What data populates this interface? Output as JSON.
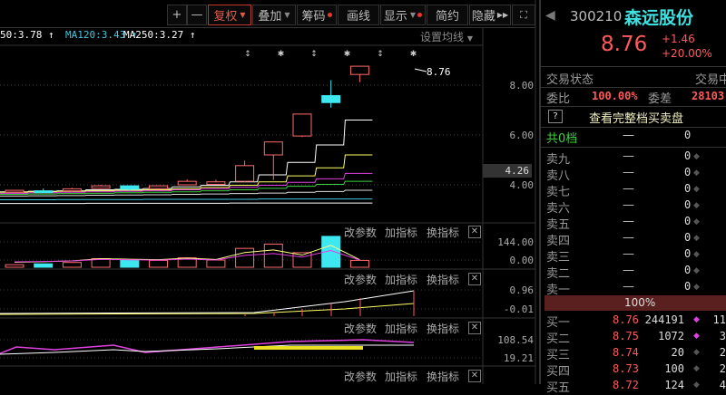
{
  "toolbar": {
    "zoom_in": "+",
    "zoom_out": "—",
    "fuquan": "复权",
    "overlay": "叠加",
    "chips": "筹码",
    "draw": "画线",
    "display": "显示",
    "simple": "简约",
    "hide": "隐藏"
  },
  "ma_legend": [
    {
      "text": "50:3.78",
      "color": "#ffffff"
    },
    {
      "text": "MA120:3.43",
      "color": "#3ec8e0"
    },
    {
      "text": "MA250:3.27",
      "color": "#ffffff"
    }
  ],
  "set_ma": "设置均线",
  "price_label": "8.76",
  "current_axis_value": "4.26",
  "main_axis": [
    "8.00",
    "6.00",
    "4.00"
  ],
  "panel_actions": {
    "params": "改参数",
    "add": "加指标",
    "swap": "换指标",
    "close": "✕"
  },
  "panels": [
    {
      "axis": [
        "144.00",
        "0.00"
      ]
    },
    {
      "axis": [
        "0.96",
        "-0.01"
      ]
    },
    {
      "axis": [
        "108.54",
        "19.21"
      ]
    }
  ],
  "chart_data": {
    "type": "candlestick",
    "ylim": [
      3.4,
      9.2
    ],
    "candles": [
      {
        "o": 3.72,
        "h": 3.79,
        "l": 3.7,
        "c": 3.78
      },
      {
        "o": 3.76,
        "h": 3.85,
        "l": 3.72,
        "c": 3.74
      },
      {
        "o": 3.76,
        "h": 3.88,
        "l": 3.73,
        "c": 3.84
      },
      {
        "o": 3.86,
        "h": 4.0,
        "l": 3.84,
        "c": 3.96
      },
      {
        "o": 3.96,
        "h": 3.96,
        "l": 3.78,
        "c": 3.82
      },
      {
        "o": 3.85,
        "h": 3.98,
        "l": 3.8,
        "c": 3.96
      },
      {
        "o": 4.0,
        "h": 4.22,
        "l": 3.98,
        "c": 4.14
      },
      {
        "o": 4.02,
        "h": 4.2,
        "l": 4.0,
        "c": 4.12
      },
      {
        "o": 4.14,
        "h": 4.97,
        "l": 4.1,
        "c": 4.77
      },
      {
        "o": 5.2,
        "h": 5.72,
        "l": 4.2,
        "c": 5.72
      },
      {
        "o": 5.96,
        "h": 6.84,
        "l": 5.92,
        "c": 6.84
      },
      {
        "o": 7.58,
        "h": 8.2,
        "l": 7.1,
        "c": 7.3
      },
      {
        "o": 8.43,
        "h": 8.76,
        "l": 8.12,
        "c": 8.76
      }
    ],
    "ma_series": [
      {
        "color": "#ffffff",
        "values": [
          3.72,
          3.74,
          3.76,
          3.8,
          3.82,
          3.85,
          3.92,
          3.98,
          4.12,
          4.4,
          4.9,
          5.6,
          6.6
        ]
      },
      {
        "color": "#ffff66",
        "values": [
          3.7,
          3.72,
          3.74,
          3.76,
          3.78,
          3.8,
          3.84,
          3.9,
          3.98,
          4.12,
          4.36,
          4.68,
          5.2
        ]
      },
      {
        "color": "#e040e0",
        "values": [
          3.66,
          3.68,
          3.7,
          3.72,
          3.74,
          3.76,
          3.8,
          3.84,
          3.9,
          3.98,
          4.1,
          4.24,
          4.46
        ]
      },
      {
        "color": "#40d040",
        "values": [
          3.62,
          3.63,
          3.65,
          3.66,
          3.68,
          3.7,
          3.72,
          3.76,
          3.8,
          3.86,
          3.94,
          4.02,
          4.14
        ]
      },
      {
        "color": "#dddddd",
        "values": [
          3.55,
          3.56,
          3.57,
          3.58,
          3.59,
          3.6,
          3.62,
          3.63,
          3.65,
          3.67,
          3.7,
          3.73,
          3.78
        ]
      },
      {
        "color": "#3ec8e0",
        "values": [
          3.4,
          3.4,
          3.41,
          3.41,
          3.41,
          3.42,
          3.42,
          3.42,
          3.42,
          3.43,
          3.43,
          3.43,
          3.43
        ]
      },
      {
        "color": "#ffffff",
        "values": [
          3.25,
          3.25,
          3.25,
          3.26,
          3.26,
          3.26,
          3.26,
          3.26,
          3.27,
          3.27,
          3.27,
          3.27,
          3.27
        ]
      }
    ],
    "volume": [
      15,
      20,
      28,
      50,
      45,
      40,
      55,
      42,
      110,
      135,
      85,
      180,
      40
    ],
    "volume_max": 190
  },
  "quote": {
    "code": "300210",
    "name": "森远股份",
    "price": "8.76",
    "change": "+1.46",
    "pct": "+20.00%",
    "status_label": "交易状态",
    "status_value": "交易中",
    "ratio_label": "委比",
    "ratio_value": "100.00%",
    "diff_label": "委差",
    "diff_value": "28103",
    "help": "?",
    "full_book": "查看完整档买卖盘",
    "levels_label": "共0档",
    "levels_dash": "—",
    "levels_zero": "0",
    "sells": [
      {
        "label": "卖九",
        "p": "—",
        "v": "0"
      },
      {
        "label": "卖八",
        "p": "—",
        "v": "0"
      },
      {
        "label": "卖七",
        "p": "—",
        "v": "0"
      },
      {
        "label": "卖六",
        "p": "—",
        "v": "0"
      },
      {
        "label": "卖五",
        "p": "—",
        "v": "0"
      },
      {
        "label": "卖四",
        "p": "—",
        "v": "0"
      },
      {
        "label": "卖三",
        "p": "—",
        "v": "0"
      },
      {
        "label": "卖二",
        "p": "—",
        "v": "0"
      },
      {
        "label": "卖一",
        "p": "—",
        "v": "0"
      }
    ],
    "bar_pct": "100%",
    "buys": [
      {
        "label": "买一",
        "p": "8.76",
        "v": "244191",
        "n": "11"
      },
      {
        "label": "买二",
        "p": "8.75",
        "v": "1072",
        "n": "3"
      },
      {
        "label": "买三",
        "p": "8.74",
        "v": "20",
        "n": "2"
      },
      {
        "label": "买四",
        "p": "8.73",
        "v": "100",
        "n": "2"
      },
      {
        "label": "买五",
        "p": "8.72",
        "v": "124",
        "n": "4"
      }
    ]
  }
}
